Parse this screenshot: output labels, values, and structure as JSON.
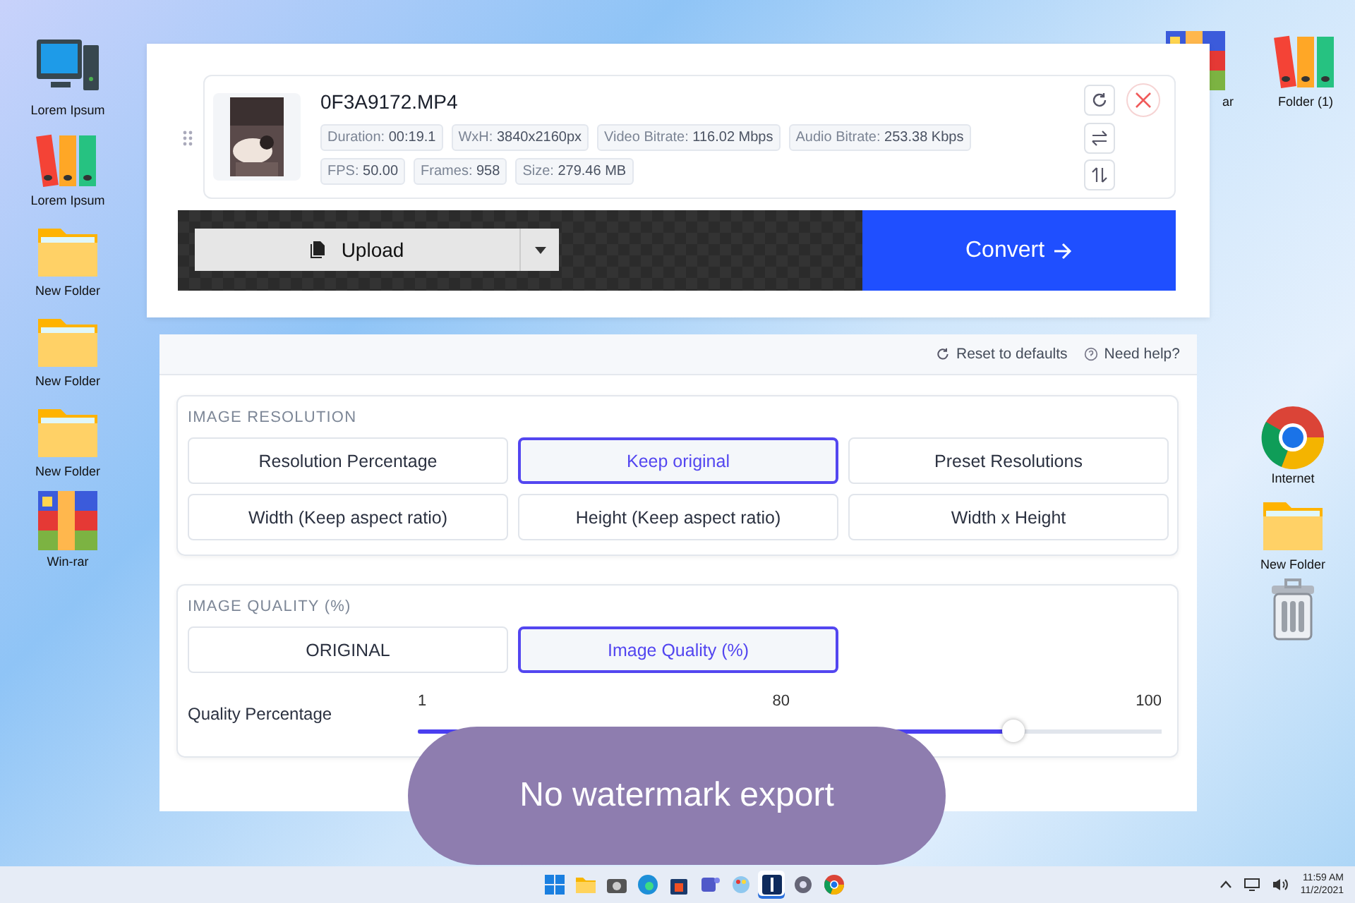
{
  "desktop_left": [
    {
      "label": "Lorem Ipsum",
      "kind": "computer"
    },
    {
      "label": "Lorem Ipsum",
      "kind": "binders"
    },
    {
      "label": "New Folder",
      "kind": "folder"
    },
    {
      "label": "New Folder",
      "kind": "folder"
    },
    {
      "label": "New Folder",
      "kind": "folder"
    },
    {
      "label": "Win-rar",
      "kind": "winrar"
    }
  ],
  "desktop_right_top": [
    {
      "label": "ar",
      "kind": "winrar"
    },
    {
      "label": "Folder (1)",
      "kind": "binders"
    }
  ],
  "desktop_right": [
    {
      "label": "Internet",
      "kind": "chrome"
    },
    {
      "label": "New Folder",
      "kind": "folder"
    },
    {
      "kind": "trash"
    }
  ],
  "converter": {
    "file": {
      "name": "0F3A9172.MP4",
      "chips": [
        {
          "label": "Duration:",
          "value": "00:19.1"
        },
        {
          "label": "WxH:",
          "value": "3840x2160px"
        },
        {
          "label": "Video Bitrate:",
          "value": "116.02 Mbps"
        },
        {
          "label": "Audio Bitrate:",
          "value": "253.38 Kbps"
        },
        {
          "label": "FPS:",
          "value": "50.00"
        },
        {
          "label": "Frames:",
          "value": "958"
        },
        {
          "label": "Size:",
          "value": "279.46 MB"
        }
      ]
    },
    "upload": "Upload",
    "convert": "Convert"
  },
  "settings": {
    "links": [
      "Reset to defaults",
      "Need help?"
    ],
    "sections": [
      {
        "title": "IMAGE RESOLUTION",
        "options": [
          {
            "label": "Resolution Percentage",
            "selected": false
          },
          {
            "label": "Keep original",
            "selected": true
          },
          {
            "label": "Preset Resolutions",
            "selected": false
          },
          {
            "label": "Width (Keep aspect ratio)",
            "selected": false
          },
          {
            "label": "Height (Keep aspect ratio)",
            "selected": false
          },
          {
            "label": "Width x Height",
            "selected": false
          }
        ]
      },
      {
        "title": "IMAGE QUALITY (%)",
        "options": [
          {
            "label": "ORIGINAL",
            "selected": false
          },
          {
            "label": "Image Quality (%)",
            "selected": true
          }
        ],
        "slider": {
          "label": "Quality Percentage",
          "ticks": [
            "1",
            "80",
            "100"
          ],
          "level": 0.8
        }
      }
    ]
  },
  "caption": "No watermark export",
  "taskbar": {
    "apps": [
      {
        "kind": "start",
        "selected": false
      },
      {
        "kind": "explorer",
        "selected": false
      },
      {
        "kind": "camera",
        "selected": false
      },
      {
        "kind": "edge",
        "selected": false
      },
      {
        "kind": "store",
        "selected": false
      },
      {
        "kind": "teams",
        "selected": false
      },
      {
        "kind": "paint",
        "selected": false
      },
      {
        "kind": "converter",
        "selected": true
      },
      {
        "kind": "settings",
        "selected": false
      },
      {
        "kind": "chrome",
        "selected": false
      }
    ],
    "time": "11:59 AM",
    "date": "11/2/2021"
  }
}
